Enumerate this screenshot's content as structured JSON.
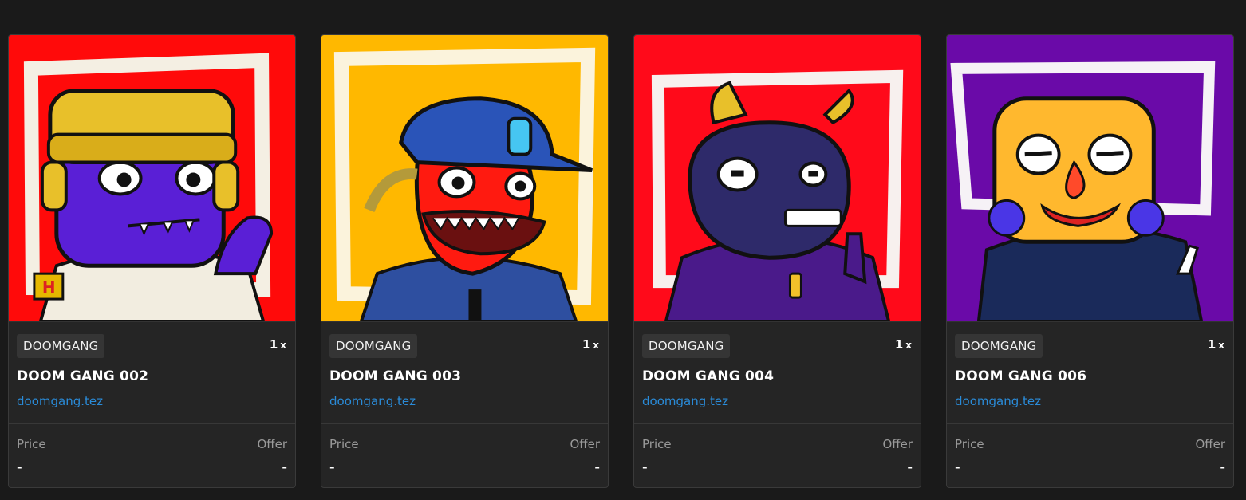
{
  "cards": [
    {
      "collection": "DOOMGANG",
      "edition_count": "1",
      "edition_suffix": "x",
      "title": "DOOM GANG 002",
      "creator": "doomgang.tez",
      "price_label": "Price",
      "price_value": "-",
      "offer_label": "Offer",
      "offer_value": "-",
      "art_background": "#ff0a0a",
      "art_skin": "#5a1fd6"
    },
    {
      "collection": "DOOMGANG",
      "edition_count": "1",
      "edition_suffix": "x",
      "title": "DOOM GANG 003",
      "creator": "doomgang.tez",
      "price_label": "Price",
      "price_value": "-",
      "offer_label": "Offer",
      "offer_value": "-",
      "art_background": "#ffb800",
      "art_skin": "#ff1a10"
    },
    {
      "collection": "DOOMGANG",
      "edition_count": "1",
      "edition_suffix": "x",
      "title": "DOOM GANG 004",
      "creator": "doomgang.tez",
      "price_label": "Price",
      "price_value": "-",
      "offer_label": "Offer",
      "offer_value": "-",
      "art_background": "#ff0a1a",
      "art_skin": "#2e2a6a"
    },
    {
      "collection": "DOOMGANG",
      "edition_count": "1",
      "edition_suffix": "x",
      "title": "DOOM GANG 006",
      "creator": "doomgang.tez",
      "price_label": "Price",
      "price_value": "-",
      "offer_label": "Offer",
      "offer_value": "-",
      "art_background": "#6a0aa8",
      "art_skin": "#ffb82e"
    }
  ]
}
